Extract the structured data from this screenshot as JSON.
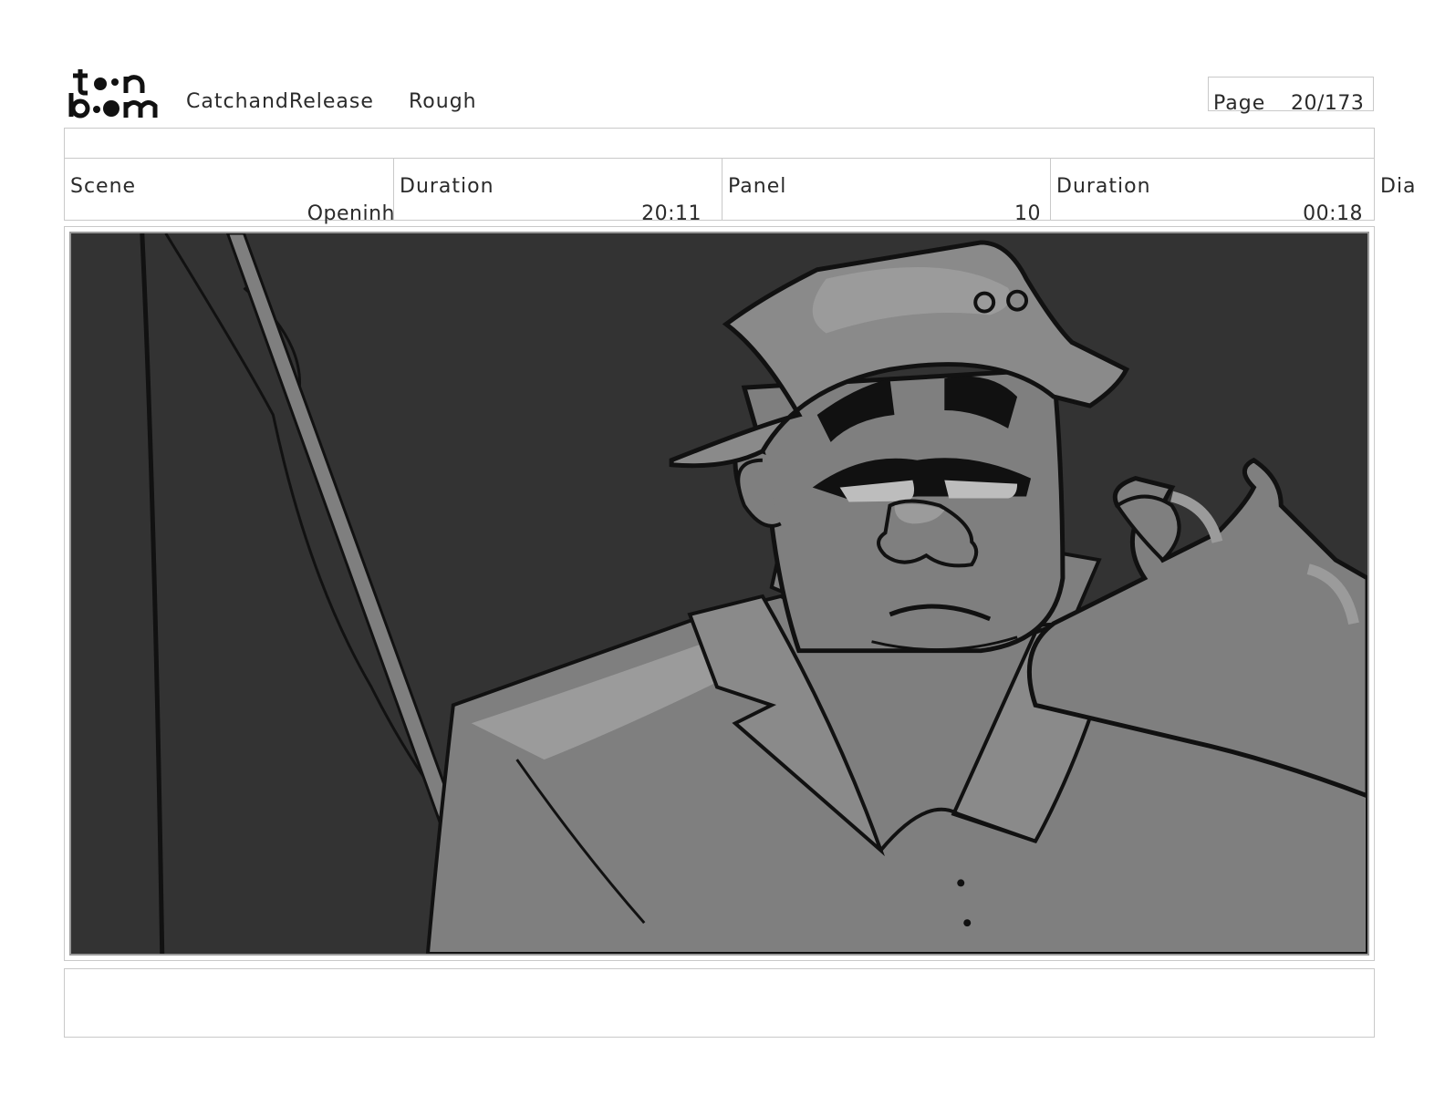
{
  "header": {
    "project": "CatchandRelease",
    "stage": "Rough",
    "page_label": "Page",
    "page_value": "20/173"
  },
  "info": {
    "scene_label": "Scene",
    "scene_value": "Openinh",
    "scene_duration_label": "Duration",
    "scene_duration_value": "20:11",
    "panel_label": "Panel",
    "panel_value": "10",
    "panel_duration_label": "Duration",
    "panel_duration_value": "00:18",
    "dialogue_label": "Dia"
  },
  "colors": {
    "background": "#333333",
    "mid_gray": "#7f7f7f",
    "light_gray": "#9b9b9b",
    "line": "#111111"
  }
}
